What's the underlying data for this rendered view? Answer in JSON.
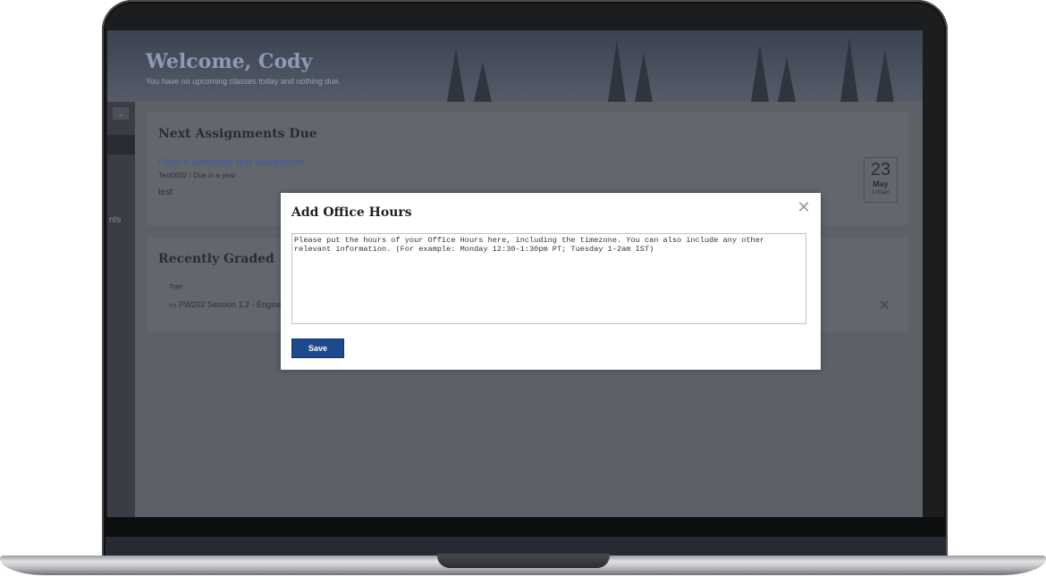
{
  "dashboard": {
    "welcome_title": "Welcome, Cody",
    "welcome_subtitle": "You have no upcoming classes today and nothing due.",
    "sidebar_partial_text": "nts",
    "next_assignments": {
      "title": "Next Assignments Due",
      "assignment_name": "Peter's awesome test assignment",
      "assignment_meta": "Test0002 / Due in a year",
      "assignment_desc": "test",
      "date_day": "23",
      "date_month": "May",
      "date_time": "1:00am"
    },
    "recently_graded": {
      "title": "Recently Graded",
      "type_label": "Type",
      "row_text": "PW202 Session 1.2 - Engine"
    }
  },
  "modal": {
    "title": "Add Office Hours",
    "textarea_placeholder": "Please put the hours of your Office Hours here, including the timezone. You can also include any other relevant information. (For example: Monday 12:30-1:30pm PT; Tuesday 1-2am IST)",
    "save_label": "Save",
    "close_icon": "close-icon"
  }
}
